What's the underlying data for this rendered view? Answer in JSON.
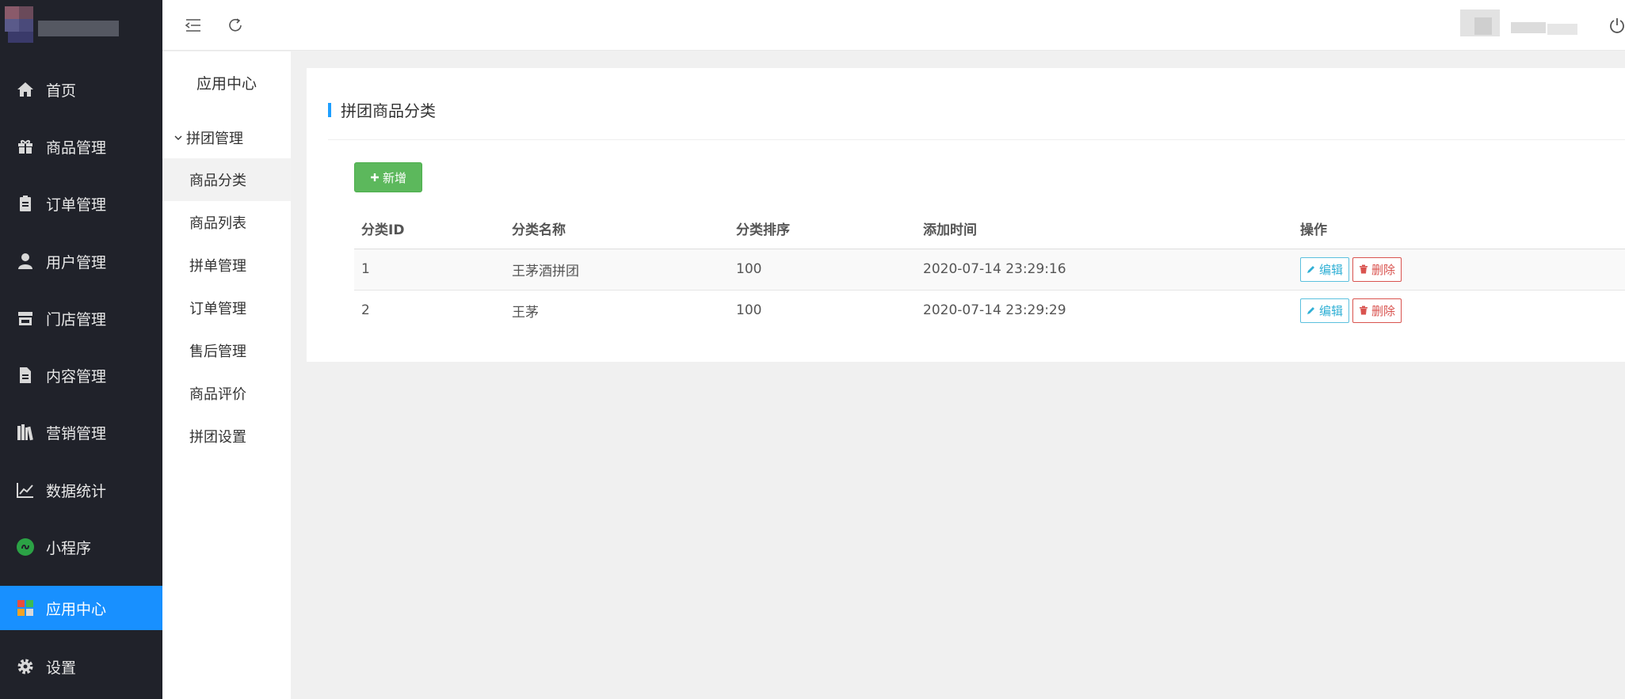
{
  "colors": {
    "sidebar_bg": "#20222a",
    "active": "#1890ff",
    "accent_bar": "#1e9fff",
    "add_green": "#5cb85c",
    "edit": "#5bc0de",
    "delete": "#d9534f"
  },
  "sidebar": {
    "items": [
      {
        "label": "首页",
        "icon": "home-icon"
      },
      {
        "label": "商品管理",
        "icon": "gift-icon"
      },
      {
        "label": "订单管理",
        "icon": "clipboard-icon"
      },
      {
        "label": "用户管理",
        "icon": "user-icon"
      },
      {
        "label": "门店管理",
        "icon": "store-icon"
      },
      {
        "label": "内容管理",
        "icon": "document-icon"
      },
      {
        "label": "营销管理",
        "icon": "books-icon"
      },
      {
        "label": "数据统计",
        "icon": "line-chart-icon"
      },
      {
        "label": "小程序",
        "icon": "mini-program-icon"
      },
      {
        "label": "应用中心",
        "icon": "apps-icon",
        "active": true
      },
      {
        "label": "设置",
        "icon": "gear-icon"
      }
    ]
  },
  "subnav": {
    "title": "应用中心",
    "group": "拼团管理",
    "items": [
      "商品分类",
      "商品列表",
      "拼单管理",
      "订单管理",
      "售后管理",
      "商品评价",
      "拼团设置"
    ],
    "active_index": 0
  },
  "main": {
    "title": "拼团商品分类",
    "add_label": "新增",
    "columns": [
      "分类ID",
      "分类名称",
      "分类排序",
      "添加时间",
      "操作"
    ],
    "rows": [
      {
        "id": "1",
        "name": "王茅酒拼团",
        "sort": "100",
        "time": "2020-07-14 23:29:16"
      },
      {
        "id": "2",
        "name": "王茅",
        "sort": "100",
        "time": "2020-07-14 23:29:29"
      }
    ],
    "edit_label": "编辑",
    "delete_label": "删除"
  }
}
